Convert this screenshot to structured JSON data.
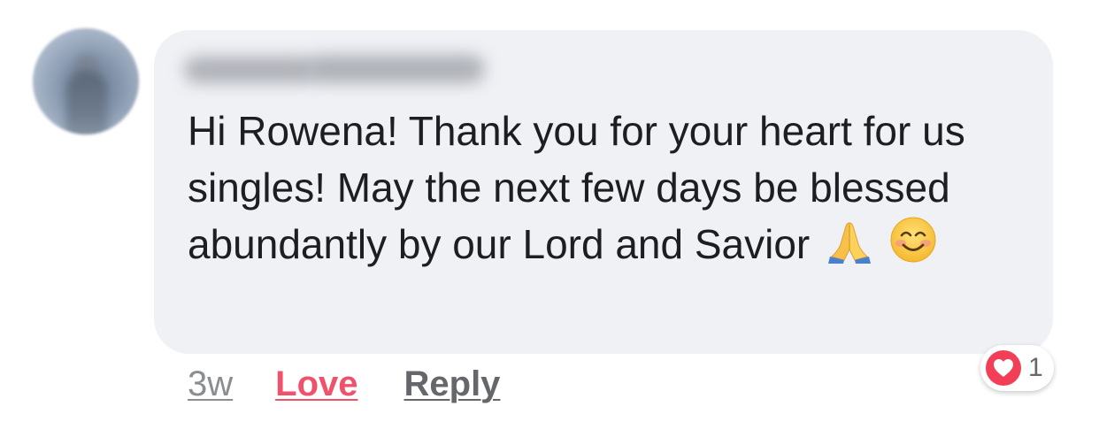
{
  "comment": {
    "author": "",
    "text": "Hi Rowena! Thank you for your heart for us singles! May the next few days be blessed abundantly by our Lord and Savior",
    "emojis": [
      "folded-hands-icon",
      "smiling-face-icon"
    ]
  },
  "actions": {
    "timestamp": "3w",
    "love_label": "Love",
    "reply_label": "Reply"
  },
  "reactions": {
    "icon": "heart-icon",
    "count": "1"
  },
  "colors": {
    "bubble": "#eff1f5",
    "love": "#f0516b",
    "heart": "#f33e58",
    "text": "#1c1e21",
    "muted": "#8a8d91"
  }
}
